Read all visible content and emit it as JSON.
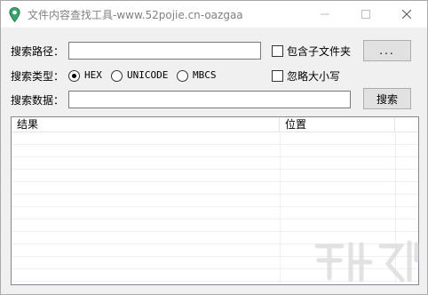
{
  "titlebar": {
    "title": "文件内容查找工具-www.52pojie.cn-oazgaa",
    "icon": "map-pin-icon"
  },
  "form": {
    "path_label": "搜索路径：",
    "path_value": "",
    "include_subfolders_label": "包含子文件夹",
    "include_subfolders_checked": false,
    "browse_label": "...",
    "type_label": "搜索类型：",
    "type_options": [
      {
        "label": "HEX",
        "checked": true
      },
      {
        "label": "UNICODE",
        "checked": false
      },
      {
        "label": "MBCS",
        "checked": false
      }
    ],
    "ignore_case_label": "忽略大小写",
    "ignore_case_checked": false,
    "data_label": "搜索数据：",
    "data_value": "",
    "search_label": "搜索"
  },
  "results": {
    "columns": [
      "结果",
      "位置"
    ]
  },
  "colors": {
    "window_bg": "#f0f0f0",
    "titlebar_bg": "#ffffff",
    "accent_green": "#2e8b57"
  }
}
